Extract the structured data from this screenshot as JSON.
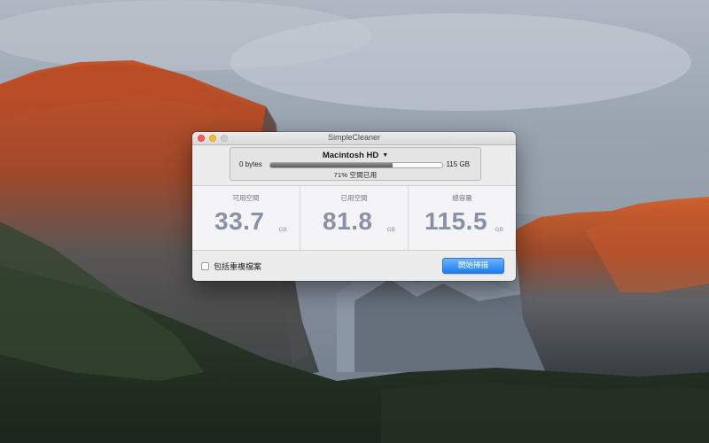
{
  "window": {
    "title": "SimpleCleaner"
  },
  "disk": {
    "name": "Macintosh HD",
    "dropdown_arrow": "▼",
    "min_label": "0 bytes",
    "max_label": "115 GB",
    "used_fraction": 0.71,
    "caption": "71% 空間已用"
  },
  "stats": [
    {
      "label": "可用空間",
      "value": "33.7",
      "unit": "GB"
    },
    {
      "label": "已用空間",
      "value": "81.8",
      "unit": "GB"
    },
    {
      "label": "總容量",
      "value": "115.5",
      "unit": "GB"
    }
  ],
  "footer": {
    "checkbox_label": "包括重複檔案",
    "checkbox_checked": false,
    "scan_button_label": "開始掃描"
  },
  "colors": {
    "accent": "#1b7ef5",
    "stat_text": "#8a90a6",
    "close": "#fc5f57",
    "minimize": "#fdbb2e",
    "zoom": "#cfcfcf"
  }
}
